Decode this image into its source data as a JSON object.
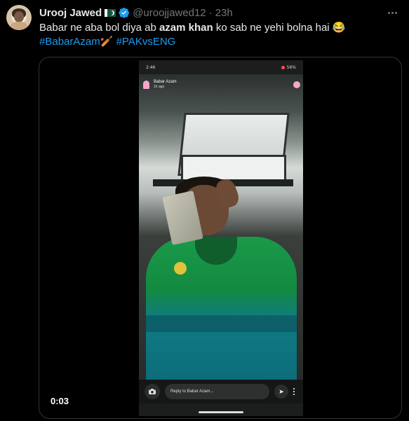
{
  "author": {
    "name": "Urooj Jawed",
    "flag": "pakistan-flag",
    "handle": "@uroojjawed12",
    "separator": "·",
    "time": "23h"
  },
  "tweet": {
    "text_before": "Babar ne aba bol diya ab ",
    "text_bold": "azam khan",
    "text_after": " ko sab ne yehi bolna hai 😂",
    "hashtag1": "#BabarAzam",
    "hashtag1_emoji": "🏏",
    "hashtag2": "#PAKvsENG"
  },
  "video": {
    "duration": "0:03",
    "phone_status": {
      "time": "2:46",
      "battery": "56%"
    },
    "snap": {
      "user": "Babar Azam",
      "ago": "1h ago",
      "reply_placeholder": "Reply to Babar Azam..."
    }
  },
  "colors": {
    "accent": "#1d9bf0",
    "background": "#000000",
    "muted": "#71767b"
  }
}
